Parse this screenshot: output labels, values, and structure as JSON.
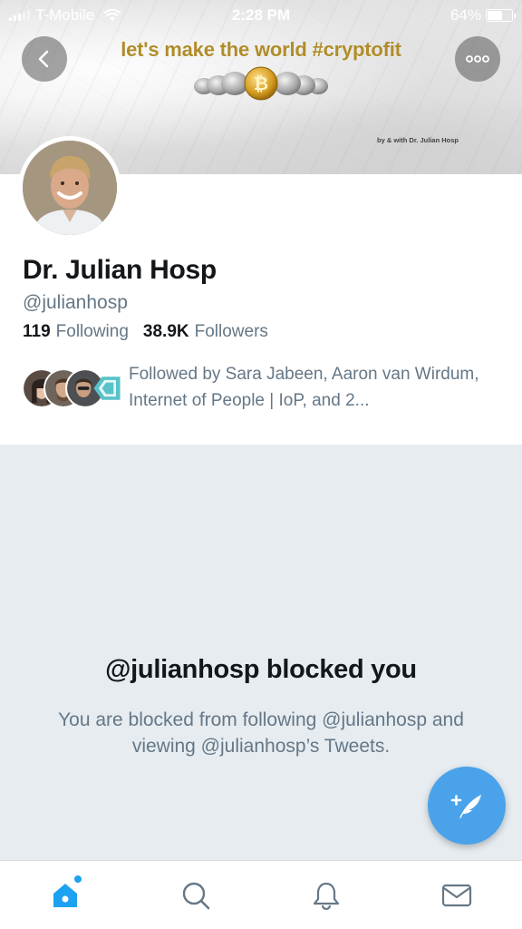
{
  "status_bar": {
    "carrier": "T-Mobile",
    "time": "2:28 PM",
    "battery_percent": "64%",
    "battery_level": 0.64
  },
  "banner": {
    "headline": "let's make the world #cryptofit",
    "credit": "by & with Dr. Julian Hosp",
    "icons": {
      "back": "chevron-left-icon",
      "more": "more-horizontal-icon"
    }
  },
  "profile": {
    "display_name": "Dr. Julian Hosp",
    "handle": "@julianhosp",
    "following_count": "119",
    "following_label": "Following",
    "followers_count": "38.9K",
    "followers_label": "Followers",
    "followed_by_text": "Followed by Sara Jabeen, Aaron van Wirdum, Internet of People | IoP, and 2..."
  },
  "blocked": {
    "title": "@julianhosp blocked you",
    "description": "You are blocked from following @julianhosp and viewing @julianhosp’s Tweets."
  },
  "fab": {
    "icon": "compose-tweet-icon"
  },
  "tab_bar": {
    "tabs": [
      {
        "name": "home",
        "icon": "home-icon",
        "active": true
      },
      {
        "name": "search",
        "icon": "search-icon",
        "active": false
      },
      {
        "name": "notifications",
        "icon": "bell-icon",
        "active": false
      },
      {
        "name": "messages",
        "icon": "mail-icon",
        "active": false
      }
    ]
  },
  "colors": {
    "accent": "#1da1f2",
    "fab": "#4aa3ea",
    "secondary_text": "#657786",
    "primary_text": "#14171a",
    "page_background": "#e6ecf0",
    "banner_headline": "#b08d2a"
  }
}
